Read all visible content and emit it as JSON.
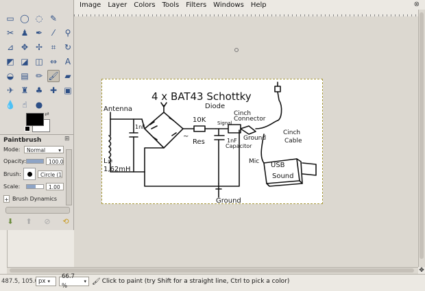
{
  "menubar": {
    "items": [
      "Image",
      "Layer",
      "Colors",
      "Tools",
      "Filters",
      "Windows",
      "Help"
    ]
  },
  "window": {
    "close_label": "⊗"
  },
  "toolbox": {
    "tools": [
      {
        "name": "rect-select-icon",
        "glyph": "▭"
      },
      {
        "name": "ellipse-select-icon",
        "glyph": "◯"
      },
      {
        "name": "free-select-icon",
        "glyph": "◌"
      },
      {
        "name": "fuzzy-select-icon",
        "glyph": "✎"
      },
      {
        "name": "placeholder-icon",
        "glyph": ""
      },
      {
        "name": "scissors-icon",
        "glyph": "✂"
      },
      {
        "name": "foreground-select-icon",
        "glyph": "♟"
      },
      {
        "name": "paths-icon",
        "glyph": "✒"
      },
      {
        "name": "color-picker-icon",
        "glyph": "⁄"
      },
      {
        "name": "zoom-icon",
        "glyph": "⚲"
      },
      {
        "name": "measure-icon",
        "glyph": "⊿"
      },
      {
        "name": "move-icon",
        "glyph": "✥"
      },
      {
        "name": "align-icon",
        "glyph": "✢"
      },
      {
        "name": "crop-icon",
        "glyph": "⌗"
      },
      {
        "name": "rotate-icon",
        "glyph": "↻"
      },
      {
        "name": "scale-icon",
        "glyph": "◩"
      },
      {
        "name": "shear-icon",
        "glyph": "◪"
      },
      {
        "name": "perspective-icon",
        "glyph": "◫"
      },
      {
        "name": "flip-icon",
        "glyph": "⇔"
      },
      {
        "name": "text-icon",
        "glyph": "A"
      },
      {
        "name": "bucket-fill-icon",
        "glyph": "◒"
      },
      {
        "name": "blend-icon",
        "glyph": "▤"
      },
      {
        "name": "pencil-icon",
        "glyph": "✏"
      },
      {
        "name": "paintbrush-icon",
        "glyph": "🖌"
      },
      {
        "name": "eraser-icon",
        "glyph": "▰"
      },
      {
        "name": "airbrush-icon",
        "glyph": "✈"
      },
      {
        "name": "ink-icon",
        "glyph": "♜"
      },
      {
        "name": "clone-icon",
        "glyph": "♣"
      },
      {
        "name": "heal-icon",
        "glyph": "✚"
      },
      {
        "name": "perspective-clone-icon",
        "glyph": "▣"
      },
      {
        "name": "blur-icon",
        "glyph": "💧"
      },
      {
        "name": "smudge-icon",
        "glyph": "☝"
      },
      {
        "name": "dodge-burn-icon",
        "glyph": "●"
      }
    ],
    "active_tool": "paintbrush-icon"
  },
  "tool_options": {
    "title": "Paintbrush",
    "mode_label": "Mode:",
    "mode_value": "Normal",
    "opacity_label": "Opacity:",
    "opacity_value": "100.0",
    "opacity_level": 1.0,
    "brush_label": "Brush:",
    "brush_value": "Circle (11)",
    "scale_label": "Scale:",
    "scale_value": "1.00",
    "scale_level": 0.55,
    "dynamics_label": "Brush Dynamics"
  },
  "drawing": {
    "title_line1": "4 x BAT43 Schottky",
    "title_line2": "Diode",
    "antenna": "Antenna",
    "cap1": "1nF",
    "inductor": "L=",
    "inductance": "1,62mH",
    "res_value": "10K",
    "res_label": "Res",
    "signal": "Signal",
    "cap2": "1nF",
    "capacitor": "Capacitor",
    "cinch_connector_1": "Cinch",
    "cinch_connector_2": "Connector",
    "ground_top": "Ground",
    "cinch_cable_1": "Cinch",
    "cinch_cable_2": "Cable",
    "mic": "Mic",
    "usb_1": "USB",
    "usb_2": "Sound",
    "ground_bottom": "Ground",
    "tilde": "~"
  },
  "statusbar": {
    "coords": "487.5, 105.0",
    "unit": "px",
    "zoom": "66.7 %",
    "message": "Click to paint (try Shift for a straight line, Ctrl to pick a color)"
  }
}
